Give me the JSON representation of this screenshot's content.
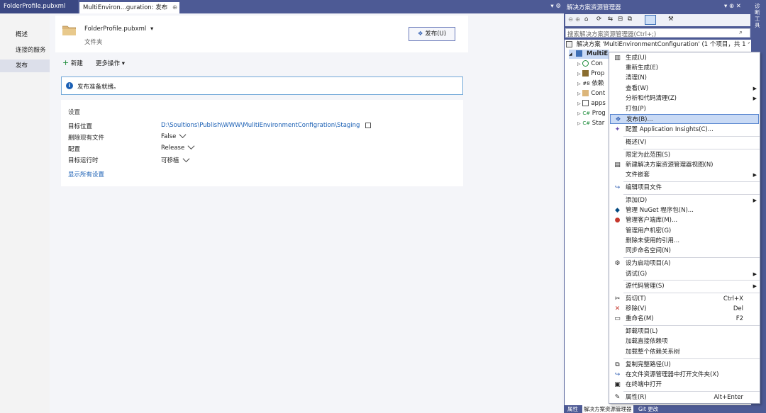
{
  "tabs": [
    {
      "label": "FolderProfile.pubxml"
    },
    {
      "label": "MultiEnviron...guration: 发布",
      "pin": "⊕",
      "close": "✕"
    }
  ],
  "tabbar_controls": "▾ ⚙",
  "sidenav": {
    "items": [
      "概述",
      "连接的服务",
      "发布"
    ],
    "selected": 2
  },
  "profile": {
    "name": "FolderProfile.pubxml",
    "dropdown": "▾",
    "subtitle": "文件夹",
    "publish_button": "发布(U)"
  },
  "toolbar": {
    "new_label": "新建",
    "new_icon": "+",
    "more_label": "更多操作",
    "more_arrow": "▾"
  },
  "info": {
    "icon": "i",
    "text": "发布准备就绪。"
  },
  "settings": {
    "title": "设置",
    "rows": [
      {
        "label": "目标位置",
        "value": "D:\\Soultions\\Publish\\WWW\\MulitiEnvironmentConfigration\\Staging"
      },
      {
        "label": "删除现有文件",
        "value": "False"
      },
      {
        "label": "配置",
        "value": "Release"
      },
      {
        "label": "目标运行时",
        "value": "可移植"
      }
    ],
    "show_all": "显示所有设置"
  },
  "solution_explorer": {
    "title": "解决方案资源管理器",
    "title_controls": "▾ ⊕ ✕",
    "search_placeholder": "搜索解决方案资源管理器(Ctrl+;)",
    "search_icon": "⌕",
    "solution_line": "解决方案 'MultiEnvironmentConfiguration' (1 个项目，共 1 个)",
    "project_name": "MultiE",
    "nodes": [
      "Con",
      "Prop",
      "依赖",
      "Cont",
      "apps",
      "Prog",
      "Star"
    ],
    "vertical_label": "诊断工具",
    "bottom_tabs": [
      "属性",
      "解决方案资源管理器",
      "Git 更改"
    ],
    "colors": {
      "chrome": "#4d5a95",
      "accent": "#1a5fb4",
      "highlight": "#c9daf5"
    }
  },
  "context_menu": {
    "items": [
      {
        "label": "生成(U)",
        "icon": "build-icon"
      },
      {
        "label": "重新生成(E)"
      },
      {
        "label": "清理(N)"
      },
      {
        "label": "查看(W)",
        "submenu": true
      },
      {
        "label": "分析和代码清理(Z)",
        "submenu": true
      },
      {
        "label": "打包(P)"
      },
      {
        "label": "发布(B)...",
        "icon": "publish-icon",
        "highlighted": true
      },
      {
        "label": "配置 Application Insights(C)...",
        "icon": "insights-icon"
      },
      {
        "label": "概述(V)"
      },
      {
        "label": "限定为此范围(S)"
      },
      {
        "label": "新建解决方案资源管理器视图(N)",
        "icon": "new-view-icon"
      },
      {
        "label": "文件嵌套",
        "submenu": true
      },
      {
        "label": "编辑项目文件",
        "icon": "edit-file-icon"
      },
      {
        "label": "添加(D)",
        "submenu": true
      },
      {
        "label": "管理 NuGet 程序包(N)...",
        "icon": "nuget-icon"
      },
      {
        "label": "管理客户端库(M)...",
        "icon": "client-lib-icon"
      },
      {
        "label": "管理用户机密(G)"
      },
      {
        "label": "删除未使用的引用..."
      },
      {
        "label": "同步命名空间(N)"
      },
      {
        "label": "设为启动项目(A)",
        "icon": "gear-icon"
      },
      {
        "label": "调试(G)",
        "submenu": true
      },
      {
        "label": "源代码管理(S)",
        "submenu": true
      },
      {
        "label": "剪切(T)",
        "icon": "scissors-icon",
        "shortcut": "Ctrl+X"
      },
      {
        "label": "移除(V)",
        "icon": "remove-icon",
        "shortcut": "Del"
      },
      {
        "label": "重命名(M)",
        "icon": "rename-icon",
        "shortcut": "F2"
      },
      {
        "label": "卸载项目(L)"
      },
      {
        "label": "加载直接依赖项"
      },
      {
        "label": "加载整个依赖关系树"
      },
      {
        "label": "复制完整路径(U)",
        "icon": "copy-icon"
      },
      {
        "label": "在文件资源管理器中打开文件夹(X)",
        "icon": "open-folder-icon"
      },
      {
        "label": "在终端中打开",
        "icon": "terminal-icon"
      },
      {
        "label": "属性(R)",
        "icon": "wrench-icon",
        "shortcut": "Alt+Enter"
      }
    ]
  }
}
